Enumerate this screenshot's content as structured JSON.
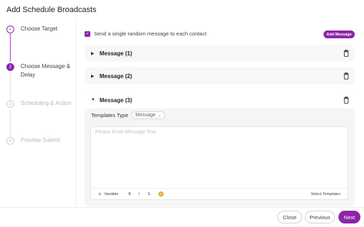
{
  "dialog": {
    "title": "Add Schedule Broadcasts"
  },
  "steps": [
    {
      "number": "✓",
      "label": "Choose Target",
      "state": "done"
    },
    {
      "number": "2",
      "label": "Choose Message & Delay",
      "state": "active"
    },
    {
      "number": "3",
      "label": "Scheduling & Action",
      "state": "pending"
    },
    {
      "number": "4",
      "label": "Preview Submit",
      "state": "pending"
    }
  ],
  "options": {
    "random_message_label": "Send a single random message to each contact",
    "random_message_checked": true,
    "add_message_label": "Add Message"
  },
  "messages": [
    {
      "title": "Message (1)",
      "expanded": false
    },
    {
      "title": "Message (2)",
      "expanded": false
    },
    {
      "title": "Message (3)",
      "expanded": true
    }
  ],
  "editor": {
    "templates_type_label": "Templates Type",
    "templates_type_value": "Message",
    "placeholder": "Please Enter Message Text",
    "value": "",
    "toolbar": {
      "variable_label": "Variable",
      "bold": "B",
      "italic": "I",
      "strike": "S",
      "select_templates_label": "Select Templates"
    }
  },
  "footer": {
    "close_label": "Close",
    "previous_label": "Previous",
    "next_label": "Next"
  },
  "colors": {
    "accent": "#8e24aa",
    "panel": "#f7f7f7"
  }
}
